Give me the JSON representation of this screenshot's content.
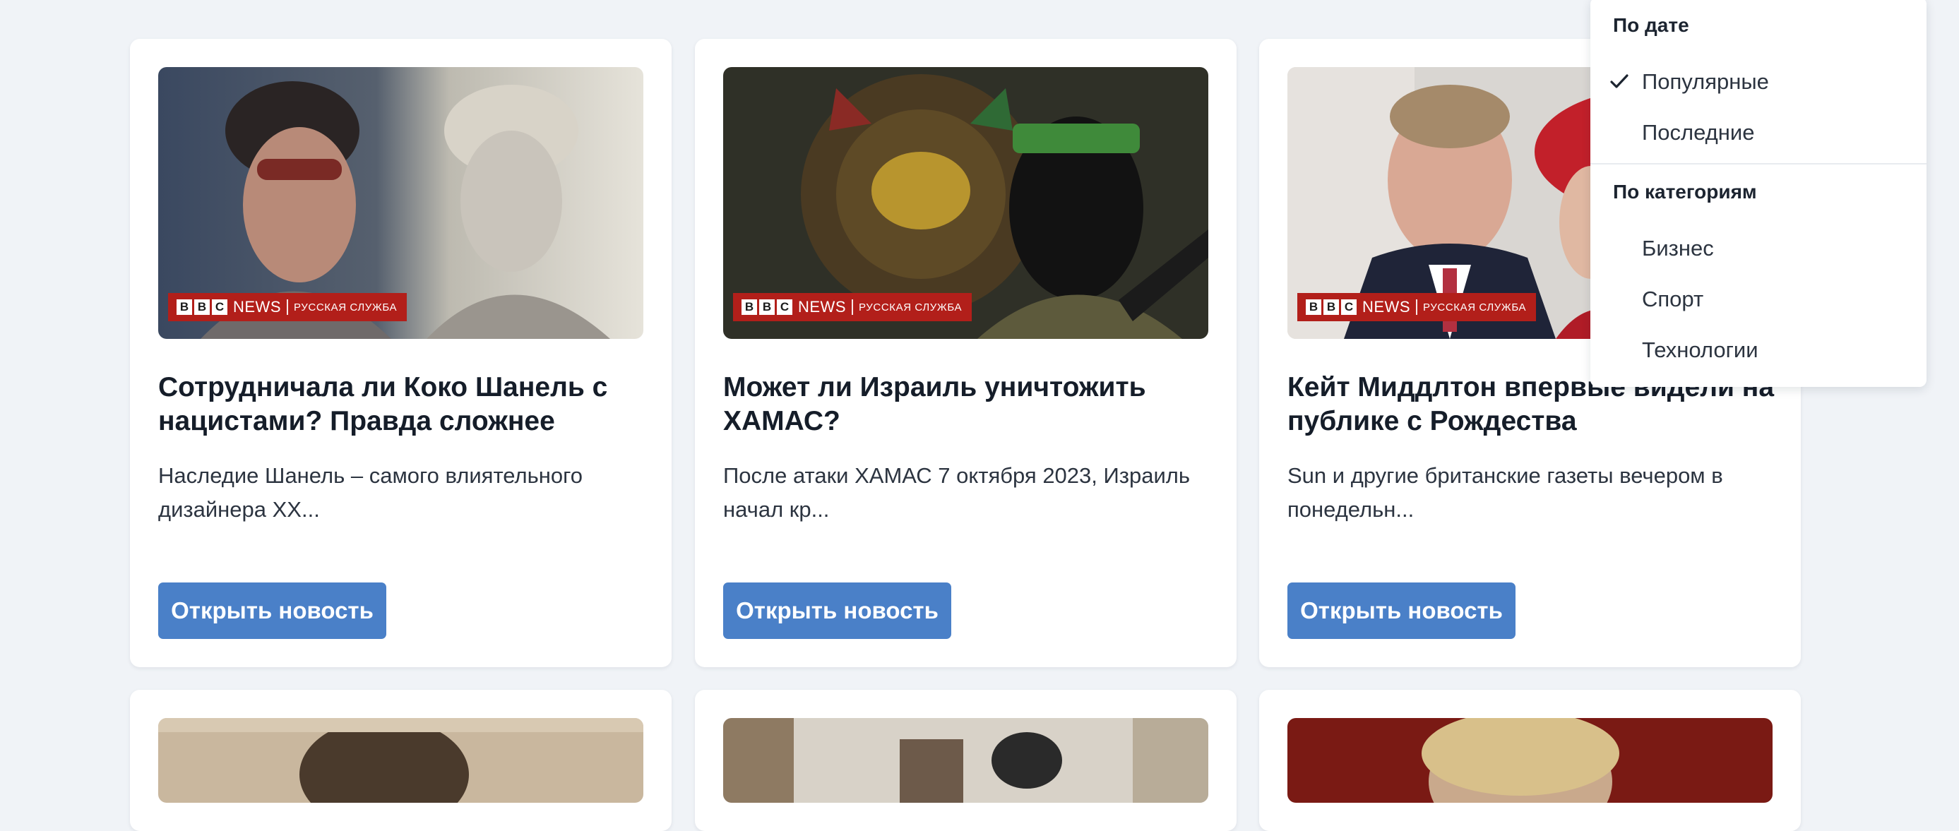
{
  "brand": {
    "news": "NEWS",
    "service": "РУССКАЯ СЛУЖБА",
    "letters": [
      "B",
      "B",
      "C"
    ]
  },
  "cards": [
    {
      "title": "Сотрудничала ли Коко Шанель с нацистами? Правда сложнее",
      "description": "Наследие Шанель – самого влиятельного дизайнера XX...",
      "button": "Открыть новость"
    },
    {
      "title": "Может ли Израиль уничтожить ХАМАС?",
      "description": "После атаки ХАМАС 7 октября 2023, Израиль начал кр...",
      "button": "Открыть новость"
    },
    {
      "title": "Кейт Миддлтон впервые видели на публике с Рождества",
      "description": "Sun и другие британские газеты вечером в понедельн...",
      "button": "Открыть новость"
    }
  ],
  "sort_menu": {
    "by_date_heading": "По дате",
    "by_date_items": [
      {
        "label": "Популярные",
        "selected": true
      },
      {
        "label": "Последние",
        "selected": false
      }
    ],
    "by_category_heading": "По категориям",
    "by_category_items": [
      {
        "label": "Бизнес"
      },
      {
        "label": "Спорт"
      },
      {
        "label": "Технологии"
      }
    ]
  },
  "colors": {
    "background": "#f0f3f7",
    "button": "#4a80c8",
    "brand_red": "#b21f1a"
  }
}
